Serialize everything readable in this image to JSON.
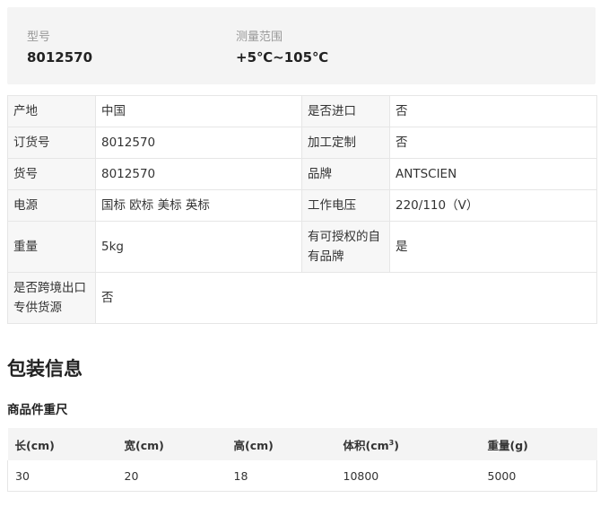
{
  "summary": {
    "model_label": "型号",
    "model_value": "8012570",
    "range_label": "测量范围",
    "range_value": "+5℃~105℃"
  },
  "specs": {
    "rows": [
      {
        "k1": "产地",
        "v1": "中国",
        "k2": "是否进口",
        "v2": "否"
      },
      {
        "k1": "订货号",
        "v1": "8012570",
        "k2": "加工定制",
        "v2": "否"
      },
      {
        "k1": "货号",
        "v1": "8012570",
        "k2": "品牌",
        "v2": "ANTSCIEN"
      },
      {
        "k1": "电源",
        "v1": "国标 欧标 美标 英标",
        "k2": "工作电压",
        "v2": "220/110（V）"
      },
      {
        "k1": "重量",
        "v1": "5kg",
        "k2": "有可授权的自有品牌",
        "v2": "是"
      },
      {
        "k1": "是否跨境出口专供货源",
        "v1": "否"
      }
    ]
  },
  "packaging": {
    "title": "包装信息",
    "subtitle": "商品件重尺",
    "headers": [
      "长(cm)",
      "宽(cm)",
      "高(cm)",
      "体积(cm",
      "3",
      ")",
      "重量(g)"
    ],
    "row": [
      "30",
      "20",
      "18",
      "10800",
      "5000"
    ]
  }
}
